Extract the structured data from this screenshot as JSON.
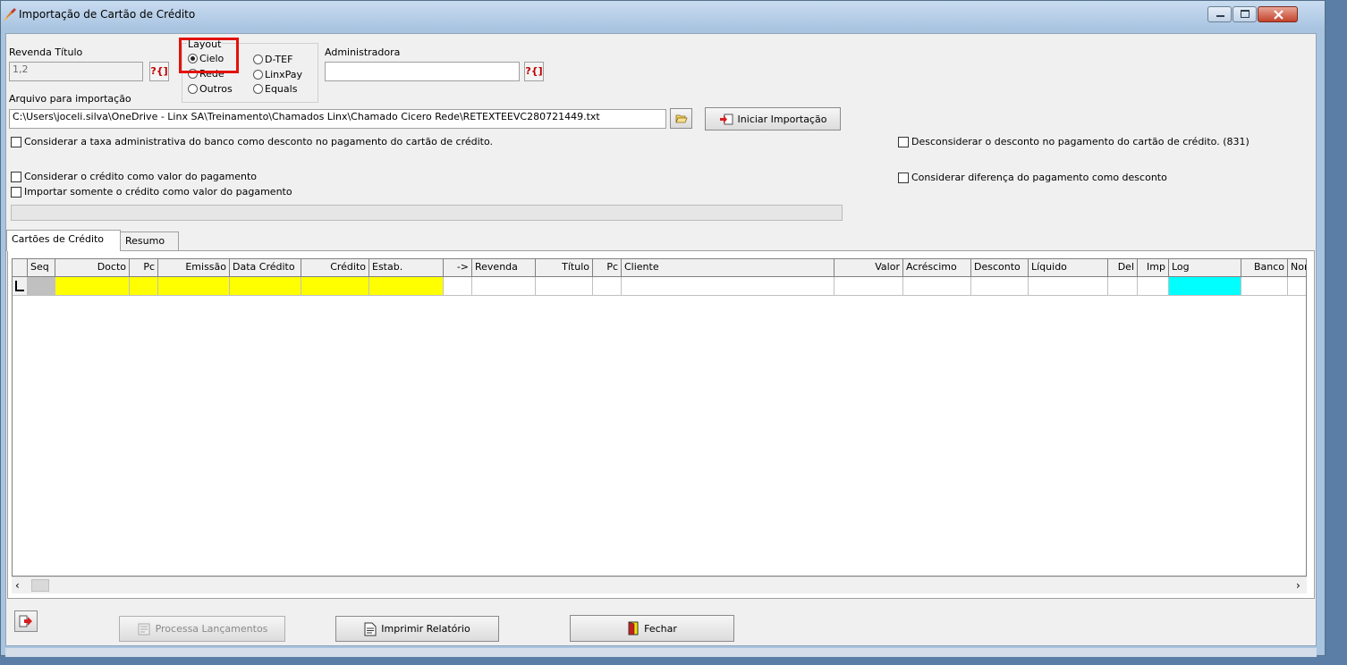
{
  "window": {
    "title": "Importação de Cartão de Crédito",
    "colors": {
      "titlebar": "#c9dcf0",
      "close": "#c4422b",
      "highlight": "#e3120b"
    }
  },
  "form": {
    "revenda_titulo_label": "Revenda Título",
    "revenda_titulo_value": "1,2",
    "lookup_label": "?{]",
    "layout": {
      "label": "Layout",
      "options": [
        "Cielo",
        "Rede",
        "Outros",
        "D-TEF",
        "LinxPay",
        "Equals"
      ],
      "selected": "Cielo"
    },
    "administradora_label": "Administradora",
    "administradora_value": "",
    "arquivo_label": "Arquivo para importação",
    "arquivo_value": "C:\\Users\\joceli.silva\\OneDrive - Linx SA\\Treinamento\\Chamados Linx\\Chamado Cicero Rede\\RETEXTEEVC280721449.txt",
    "iniciar_label": "Iniciar Importação"
  },
  "checkboxes": {
    "taxa_adm": "Considerar a taxa administrativa do banco como desconto no pagamento do cartão de crédito.",
    "desconsiderar": "Desconsiderar o desconto no pagamento do cartão de crédito. (831)",
    "credito_valor": "Considerar o crédito como valor do pagamento",
    "diferenca": "Considerar diferença do pagamento como desconto",
    "somente_credito": "Importar somente o crédito como valor do pagamento"
  },
  "tabs": [
    {
      "label": "Cartões de Crédito",
      "active": true
    },
    {
      "label": "Resumo",
      "active": false
    }
  ],
  "grid": {
    "columns": [
      "Seq",
      "Docto",
      "Pc",
      "Emissão",
      "Data Crédito",
      "Crédito",
      "Estab.",
      "->",
      "Revenda",
      "Título",
      "Pc",
      "Cliente",
      "Valor",
      "Acréscimo",
      "Desconto",
      "Líquido",
      "Del",
      "Imp",
      "Log",
      "Banco",
      "Nom"
    ],
    "highlight_colors": {
      "yellow": "#ffff00",
      "cyan": "#00ffff",
      "gray": "#c0c0c0"
    }
  },
  "buttons": {
    "processa": "Processa Lançamentos",
    "imprimir": "Imprimir Relatório",
    "fechar": "Fechar"
  }
}
